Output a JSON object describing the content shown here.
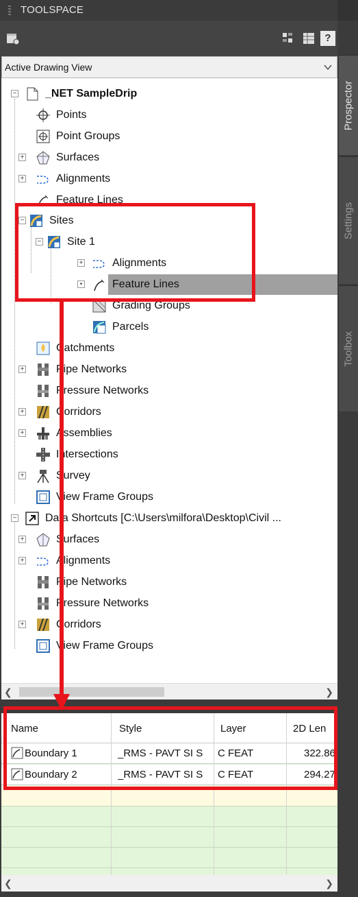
{
  "titlebar": {
    "title": "TOOLSPACE"
  },
  "toolbar": {
    "help_label": "?"
  },
  "view_select": {
    "value": "Active Drawing View"
  },
  "tree": {
    "drawing": "_NET SampleDrip",
    "points": "Points",
    "point_groups": "Point Groups",
    "surfaces": "Surfaces",
    "alignments": "Alignments",
    "feature_lines": "Feature Lines",
    "sites": "Sites",
    "site1": "Site 1",
    "site_alignments": "Alignments",
    "site_feature_lines": "Feature Lines",
    "grading_groups": "Grading Groups",
    "parcels": "Parcels",
    "catchments": "Catchments",
    "pipe_networks": "Pipe Networks",
    "pressure_networks": "Pressure Networks",
    "corridors": "Corridors",
    "assemblies": "Assemblies",
    "intersections": "Intersections",
    "survey": "Survey",
    "view_frame_groups": "View Frame Groups",
    "data_shortcuts": "Data Shortcuts [C:\\Users\\milfora\\Desktop\\Civil ...",
    "ds_surfaces": "Surfaces",
    "ds_alignments": "Alignments",
    "ds_pipe_networks": "Pipe Networks",
    "ds_pressure_networks": "Pressure Networks",
    "ds_corridors": "Corridors",
    "ds_view_frame_groups": "View Frame Groups"
  },
  "grid": {
    "columns": [
      "Name",
      "Style",
      "Layer",
      "2D Len"
    ],
    "rows": [
      {
        "name": "Boundary 1",
        "style": "_RMS - PAVT SI S",
        "layer": "C FEAT",
        "length": "322.86"
      },
      {
        "name": "Boundary 2",
        "style": "_RMS - PAVT SI S",
        "layer": "C FEAT",
        "length": "294.27"
      }
    ]
  },
  "tabs": {
    "prospector": "Prospector",
    "settings": "Settings",
    "toolbox": "Toolbox"
  },
  "colors": {
    "accent_red": "#e8141b",
    "selection": "#a0a0a0",
    "grid_bg": "#e3f6da"
  }
}
